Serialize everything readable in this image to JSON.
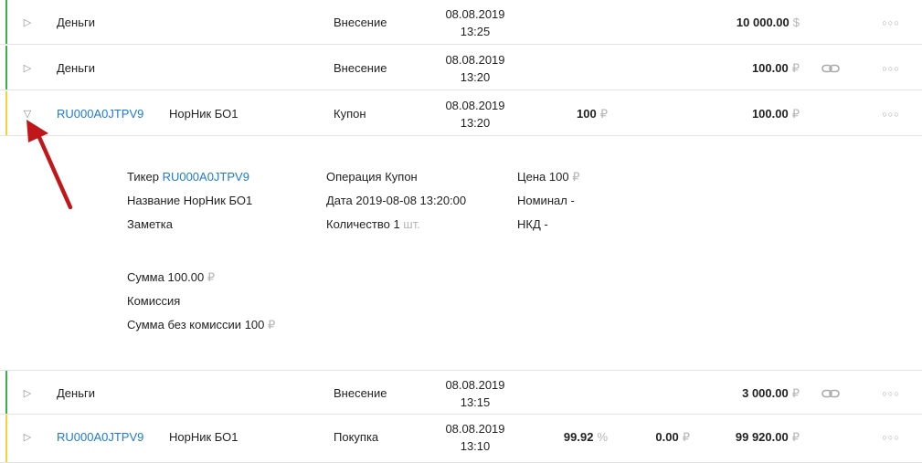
{
  "colors": {
    "money_stripe": "#3cb043",
    "coupon_stripe": "#f3d33b",
    "link": "#1e7bd2",
    "arrow": "#c0171a"
  },
  "rows": [
    {
      "name": "Деньги",
      "bond": "",
      "operation": "Внесение",
      "date": "08.08.2019",
      "time": "13:25",
      "price": "",
      "price_unit": "",
      "nkd": "",
      "nkd_unit": "",
      "sum": "10 000.00",
      "sum_unit": "$",
      "linked": false,
      "expanded": false
    },
    {
      "name": "Деньги",
      "bond": "",
      "operation": "Внесение",
      "date": "08.08.2019",
      "time": "13:20",
      "price": "",
      "price_unit": "",
      "nkd": "",
      "nkd_unit": "",
      "sum": "100.00",
      "sum_unit": "₽",
      "linked": true,
      "expanded": false
    },
    {
      "name": "RU000A0JTPV9",
      "bond": "НорНик БО1",
      "operation": "Купон",
      "date": "08.08.2019",
      "time": "13:20",
      "price": "100",
      "price_unit": "₽",
      "nkd": "",
      "nkd_unit": "",
      "sum": "100.00",
      "sum_unit": "₽",
      "linked": false,
      "expanded": true
    },
    {
      "name": "Деньги",
      "bond": "",
      "operation": "Внесение",
      "date": "08.08.2019",
      "time": "13:15",
      "price": "",
      "price_unit": "",
      "nkd": "",
      "nkd_unit": "",
      "sum": "3 000.00",
      "sum_unit": "₽",
      "linked": true,
      "expanded": false
    },
    {
      "name": "RU000A0JTPV9",
      "bond": "НорНик БО1",
      "operation": "Покупка",
      "date": "08.08.2019",
      "time": "13:10",
      "price": "99.92",
      "price_unit": "%",
      "nkd": "0.00",
      "nkd_unit": "₽",
      "sum": "99 920.00",
      "sum_unit": "₽",
      "linked": false,
      "expanded": false
    }
  ],
  "details": {
    "ticker_label": "Тикер",
    "ticker_value": "RU000A0JTPV9",
    "title_label": "Название",
    "title_value": "НорНик БО1",
    "note_label": "Заметка",
    "operation_label": "Операция",
    "operation_value": "Купон",
    "date_label": "Дата",
    "date_value": "2019-08-08 13:20:00",
    "quantity_label": "Количество",
    "quantity_value": "1",
    "quantity_unit": "шт.",
    "price_label": "Цена",
    "price_value": "100",
    "price_unit": "₽",
    "nominal_label": "Номинал",
    "nominal_value": "-",
    "nkd_label": "НКД",
    "nkd_value": "-",
    "sum_label": "Сумма",
    "sum_value": "100.00",
    "sum_unit": "₽",
    "commission_label": "Комиссия",
    "sum_no_commission_label": "Сумма без комиссии",
    "sum_no_commission_value": "100",
    "sum_no_commission_unit": "₽"
  },
  "icons": {
    "collapsed": "triangle-right-icon",
    "expanded": "triangle-down-icon",
    "link": "link-icon",
    "more": "more-dots-icon",
    "annotation": "red-arrow"
  }
}
